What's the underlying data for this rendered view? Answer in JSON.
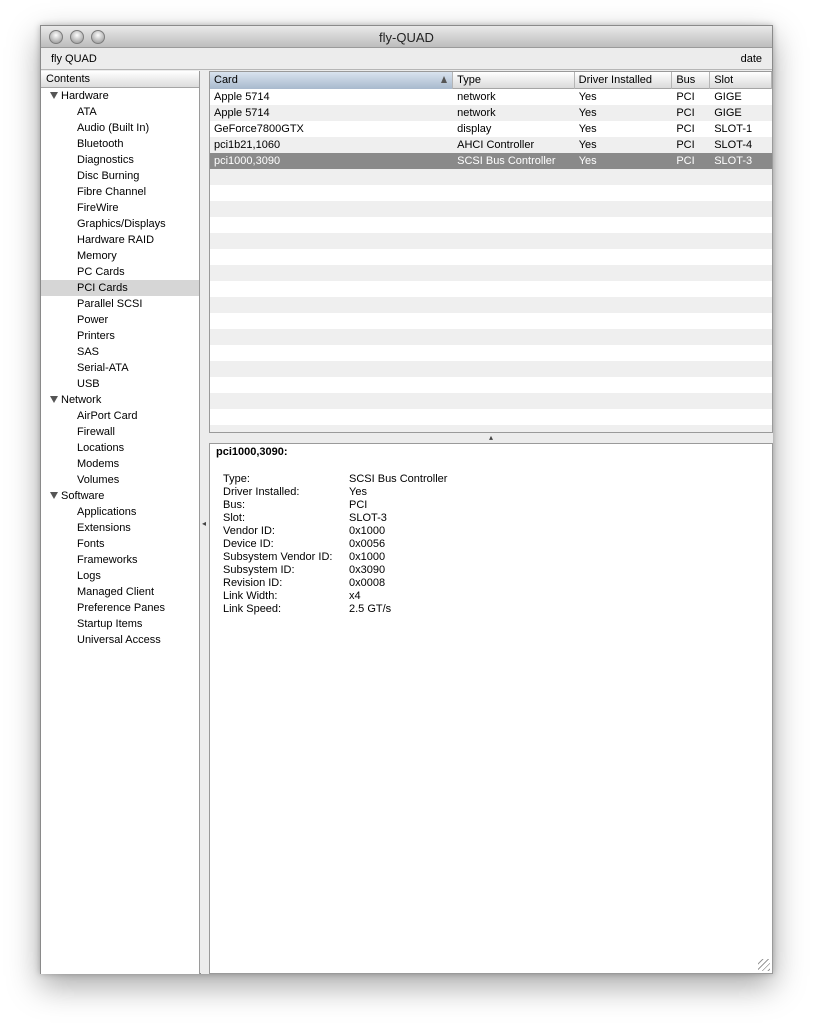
{
  "window": {
    "title": "fly-QUAD"
  },
  "infobar": {
    "machine_name": "fly QUAD",
    "date_label": "date"
  },
  "sidebar": {
    "header": "Contents",
    "groups": [
      {
        "label": "Hardware",
        "items": [
          "ATA",
          "Audio (Built In)",
          "Bluetooth",
          "Diagnostics",
          "Disc Burning",
          "Fibre Channel",
          "FireWire",
          "Graphics/Displays",
          "Hardware RAID",
          "Memory",
          "PC Cards",
          "PCI Cards",
          "Parallel SCSI",
          "Power",
          "Printers",
          "SAS",
          "Serial-ATA",
          "USB"
        ]
      },
      {
        "label": "Network",
        "items": [
          "AirPort Card",
          "Firewall",
          "Locations",
          "Modems",
          "Volumes"
        ]
      },
      {
        "label": "Software",
        "items": [
          "Applications",
          "Extensions",
          "Fonts",
          "Frameworks",
          "Logs",
          "Managed Client",
          "Preference Panes",
          "Startup Items",
          "Universal Access"
        ]
      }
    ],
    "selected": "PCI Cards"
  },
  "table": {
    "columns": [
      "Card",
      "Type",
      "Driver Installed",
      "Bus",
      "Slot"
    ],
    "sorted_column": "Card",
    "rows": [
      [
        "Apple 5714",
        "network",
        "Yes",
        "PCI",
        "GIGE"
      ],
      [
        "Apple 5714",
        "network",
        "Yes",
        "PCI",
        "GIGE"
      ],
      [
        "GeForce7800GTX",
        "display",
        "Yes",
        "PCI",
        "SLOT-1"
      ],
      [
        "pci1b21,1060",
        "AHCI Controller",
        "Yes",
        "PCI",
        "SLOT-4"
      ],
      [
        "pci1000,3090",
        "SCSI Bus Controller",
        "Yes",
        "PCI",
        "SLOT-3"
      ]
    ],
    "selected_row": 4
  },
  "detail": {
    "title": "pci1000,3090:",
    "properties": [
      [
        "Type:",
        "SCSI Bus Controller"
      ],
      [
        "Driver Installed:",
        "Yes"
      ],
      [
        "Bus:",
        "PCI"
      ],
      [
        "Slot:",
        "SLOT-3"
      ],
      [
        "Vendor ID:",
        "0x1000"
      ],
      [
        "Device ID:",
        "0x0056"
      ],
      [
        "Subsystem Vendor ID:",
        "0x1000"
      ],
      [
        "Subsystem ID:",
        "0x3090"
      ],
      [
        "Revision ID:",
        "0x0008"
      ],
      [
        "Link Width:",
        "x4"
      ],
      [
        "Link Speed:",
        "2.5 GT/s"
      ]
    ]
  }
}
